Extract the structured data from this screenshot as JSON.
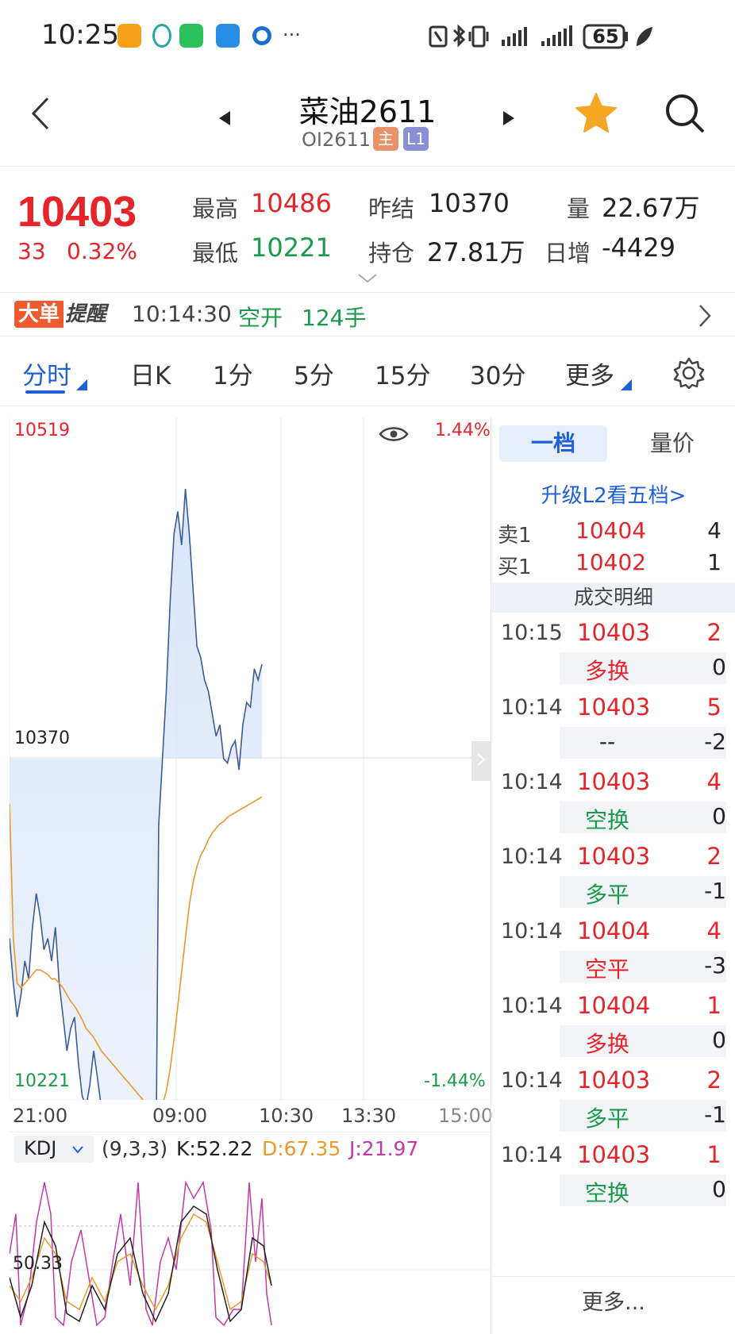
{
  "status_bar": {
    "time": "10:25",
    "battery": "65",
    "icons": [
      "app-orange-icon",
      "mobile-icon",
      "wechat-icon",
      "snow-icon",
      "browser-icon",
      "more-dots-icon",
      "nfc-icon",
      "bluetooth-icon",
      "vibrate-icon",
      "signal-icon",
      "signal-icon",
      "battery-icon",
      "leaf-icon"
    ],
    "more": "···"
  },
  "header": {
    "title": "菜油2611",
    "code": "OI2611",
    "tag_main": "主",
    "tag_level": "L1",
    "back_icon": "back-chevron-icon",
    "prev_icon": "triangle-left-icon",
    "next_icon": "triangle-right-icon",
    "favorite_icon": "star-icon",
    "search_icon": "search-icon"
  },
  "quote": {
    "last_price": "10403",
    "change": "33",
    "change_pct": "0.32%",
    "high_label": "最高",
    "high": "10486",
    "low_label": "最低",
    "low": "10221",
    "prev_settle_label": "昨结",
    "prev_settle": "10370",
    "open_interest_label": "持仓",
    "open_interest": "27.81万",
    "volume_label": "量",
    "volume": "22.67万",
    "daily_inc_label": "日增",
    "daily_inc": "-4429"
  },
  "alert": {
    "badge_left": "大单",
    "badge_right": "提醒",
    "time": "10:14:30",
    "action": "空开",
    "qty": "124手"
  },
  "tabs": [
    "分时",
    "日K",
    "1分",
    "5分",
    "15分",
    "30分",
    "更多"
  ],
  "chart": {
    "y_top": "10519",
    "y_mid": "10370",
    "y_bottom": "10221",
    "pct_top": "1.44%",
    "pct_bottom": "-1.44%",
    "x_labels": [
      "21:00",
      "09:00",
      "10:30",
      "13:30",
      "15:00"
    ],
    "kdj_label": "KDJ",
    "kdj_params": "(9,3,3)",
    "kdj_k": "K:52.22",
    "kdj_d": "D:67.35",
    "kdj_j": "J:21.97",
    "kdj_level": "50.33",
    "colors": {
      "price": "#3b5b9a",
      "avg": "#e99a2c",
      "k": "#222222",
      "d": "#e99a2c",
      "j": "#c23aa8"
    }
  },
  "chart_data": {
    "type": "line",
    "title": "",
    "xlabel": "",
    "ylabel": "",
    "ylim": [
      10221,
      10519
    ],
    "reference": 10370,
    "x_ticks": [
      "21:00",
      "09:00",
      "10:30",
      "13:30",
      "15:00"
    ],
    "series": [
      {
        "name": "",
        "values": [
          10290,
          10270,
          10255,
          10265,
          10280,
          10272,
          10295,
          10310,
          10300,
          10285,
          10290,
          10280,
          10295,
          10270,
          10255,
          10240,
          10250,
          10255,
          10235,
          10220,
          10215,
          10225,
          10240,
          10228,
          10215,
          10205,
          10190,
          10200,
          10180,
          10170,
          10165,
          10175,
          10180,
          10165,
          10155,
          10140,
          10130,
          10120,
          10125,
          10340,
          10370,
          10400,
          10440,
          10470,
          10480,
          10465,
          10490,
          10470,
          10445,
          10420,
          10415,
          10405,
          10400,
          10390,
          10380,
          10385,
          10370,
          10368,
          10375,
          10378,
          10365,
          10385,
          10395,
          10393,
          10410,
          10405,
          10412
        ]
      },
      {
        "name": "",
        "values": [
          10350,
          10290,
          10270,
          10268,
          10270,
          10272,
          10274,
          10276,
          10276,
          10275,
          10274,
          10272,
          10272,
          10270,
          10268,
          10265,
          10262,
          10260,
          10257,
          10254,
          10250,
          10248,
          10246,
          10243,
          10240,
          10238,
          10236,
          10234,
          10232,
          10230,
          10228,
          10226,
          10224,
          10222,
          10220,
          10218,
          10216,
          10215,
          10214,
          10214,
          10216,
          10222,
          10232,
          10245,
          10260,
          10275,
          10290,
          10305,
          10315,
          10322,
          10327,
          10330,
          10334,
          10337,
          10339,
          10341,
          10342,
          10344,
          10345,
          10346,
          10347,
          10348,
          10349,
          10350,
          10351,
          10352,
          10353
        ]
      }
    ]
  },
  "orderbook": {
    "tab_active": "一档",
    "tab_other": "量价",
    "upgrade_link": "升级L2看五档>",
    "ask_label": "卖1",
    "ask_price": "10404",
    "ask_vol": "4",
    "bid_label": "买1",
    "bid_price": "10402",
    "bid_vol": "1",
    "trades_header": "成交明细",
    "trades": [
      {
        "time": "10:15",
        "price": "10403",
        "vol": "2",
        "type": "多换",
        "oi": "0",
        "color": "red"
      },
      {
        "time": "10:14",
        "price": "10403",
        "vol": "5",
        "type": "--",
        "oi": "-2",
        "color": "dark"
      },
      {
        "time": "10:14",
        "price": "10403",
        "vol": "4",
        "type": "空换",
        "oi": "0",
        "color": "green"
      },
      {
        "time": "10:14",
        "price": "10403",
        "vol": "2",
        "type": "多平",
        "oi": "-1",
        "color": "green"
      },
      {
        "time": "10:14",
        "price": "10404",
        "vol": "4",
        "type": "空平",
        "oi": "-3",
        "color": "red"
      },
      {
        "time": "10:14",
        "price": "10404",
        "vol": "1",
        "type": "多换",
        "oi": "0",
        "color": "red"
      },
      {
        "time": "10:14",
        "price": "10403",
        "vol": "2",
        "type": "多平",
        "oi": "-1",
        "color": "green"
      },
      {
        "time": "10:14",
        "price": "10403",
        "vol": "1",
        "type": "空换",
        "oi": "0",
        "color": "green"
      }
    ],
    "more": "更多..."
  }
}
